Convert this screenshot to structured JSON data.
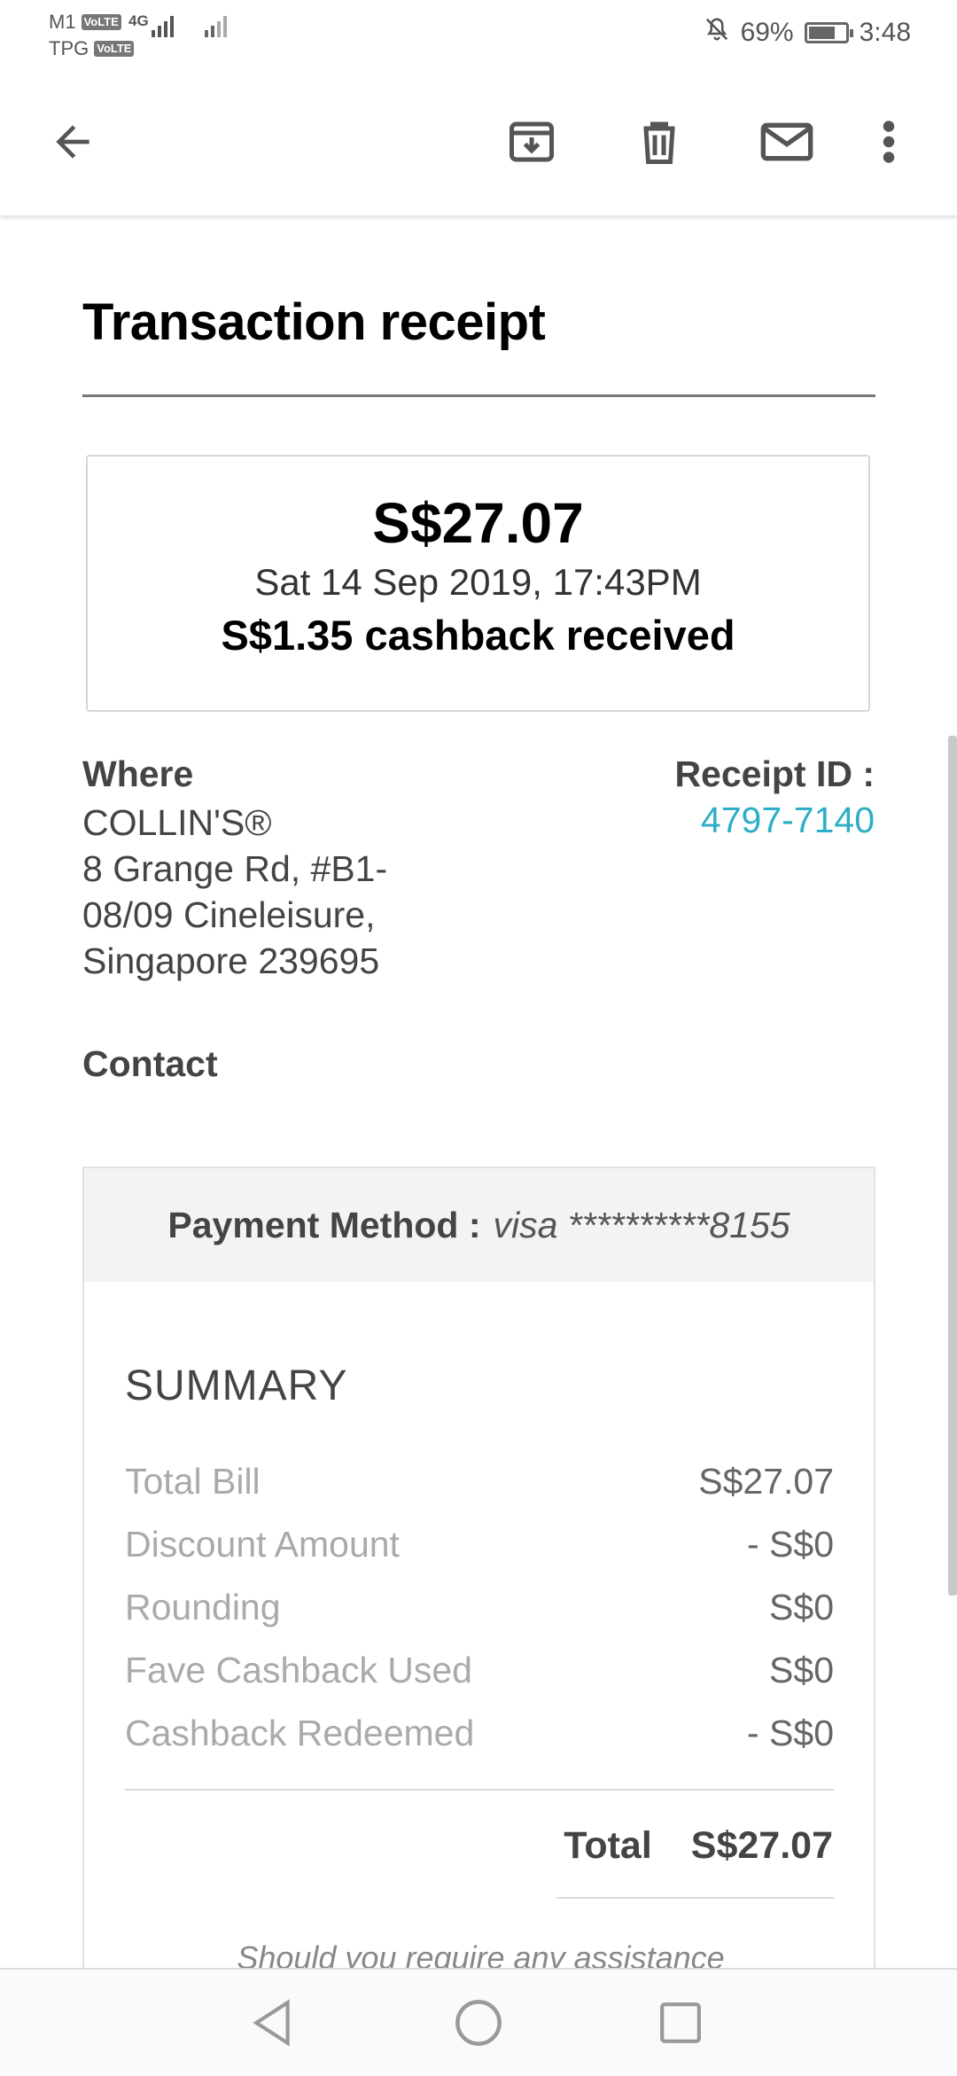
{
  "status_bar": {
    "carrier1": "M1",
    "carrier2": "TPG",
    "volte": "VoLTE",
    "network": "4G",
    "battery": "69%",
    "time": "3:48",
    "icons": [
      "volte-icon",
      "signal-icon",
      "mute-icon",
      "battery-icon"
    ]
  },
  "toolbar": {
    "icons": [
      "back-arrow-icon",
      "archive-icon",
      "delete-icon",
      "mark-unread-icon",
      "more-vert-icon"
    ]
  },
  "receipt": {
    "title": "Transaction receipt",
    "amount": "S$27.07",
    "date": "Sat 14 Sep 2019, 17:43PM",
    "cashback": "S$1.35 cashback received",
    "where_label": "Where",
    "merchant": "COLLIN'S®",
    "address": "8 Grange Rd, #B1-08/09 Cineleisure, Singapore 239695",
    "receipt_id_label": "Receipt ID :",
    "receipt_id": "4797-7140",
    "contact_label": "Contact",
    "payment_method_label": "Payment Method :",
    "payment_method_value": "visa **********8155",
    "summary_title": "SUMMARY",
    "summary_rows": [
      {
        "label": "Total Bill",
        "value": "S$27.07"
      },
      {
        "label": "Discount Amount",
        "value": "- S$0"
      },
      {
        "label": "Rounding",
        "value": "S$0"
      },
      {
        "label": "Fave Cashback Used",
        "value": "S$0"
      },
      {
        "label": "Cashback Redeemed",
        "value": "- S$0"
      }
    ],
    "total_label": "Total",
    "total_value": "S$27.07",
    "assistance": "Should you require any assistance"
  },
  "nav_bar": {
    "icons": [
      "nav-back-icon",
      "nav-home-icon",
      "nav-recents-icon"
    ]
  },
  "colors": {
    "link": "#2eaec6",
    "muted": "#aaaaaa",
    "text": "#444444"
  }
}
